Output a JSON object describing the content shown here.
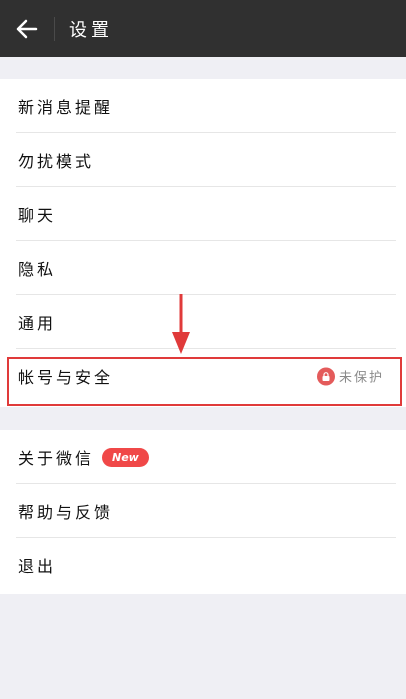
{
  "header": {
    "title": "设置",
    "back_icon": "arrow-left-icon"
  },
  "group1": [
    {
      "label": "新消息提醒"
    },
    {
      "label": "勿扰模式"
    },
    {
      "label": "聊天"
    },
    {
      "label": "隐私"
    },
    {
      "label": "通用"
    },
    {
      "label": "帐号与安全",
      "status": "未保护",
      "status_icon": "lock-icon"
    }
  ],
  "group2": [
    {
      "label": "关于微信",
      "badge": "New"
    },
    {
      "label": "帮助与反馈"
    },
    {
      "label": "退出"
    }
  ],
  "colors": {
    "topbar": "#303030",
    "accent_red": "#e03a3a",
    "badge": "#f04848",
    "background": "#efeff4"
  }
}
